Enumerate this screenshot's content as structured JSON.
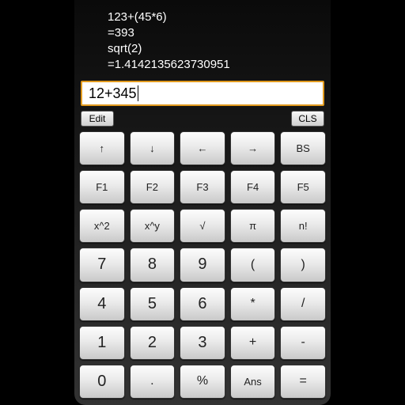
{
  "history": {
    "lines": [
      "123+(45*6)",
      "=393",
      "sqrt(2)",
      "=1.4142135623730951"
    ]
  },
  "input": {
    "value": "12+345"
  },
  "toolbar": {
    "edit_label": "Edit",
    "cls_label": "CLS"
  },
  "keys": {
    "r0": [
      "↑",
      "↓",
      "←",
      "→",
      "BS"
    ],
    "r1": [
      "F1",
      "F2",
      "F3",
      "F4",
      "F5"
    ],
    "r2": [
      "x^2",
      "x^y",
      "√",
      "π",
      "n!"
    ],
    "r3": [
      "7",
      "8",
      "9",
      "(",
      ")"
    ],
    "r4": [
      "4",
      "5",
      "6",
      "*",
      "/"
    ],
    "r5": [
      "1",
      "2",
      "3",
      "+",
      "-"
    ],
    "r6": [
      "0",
      ".",
      "%",
      "Ans",
      "="
    ]
  }
}
